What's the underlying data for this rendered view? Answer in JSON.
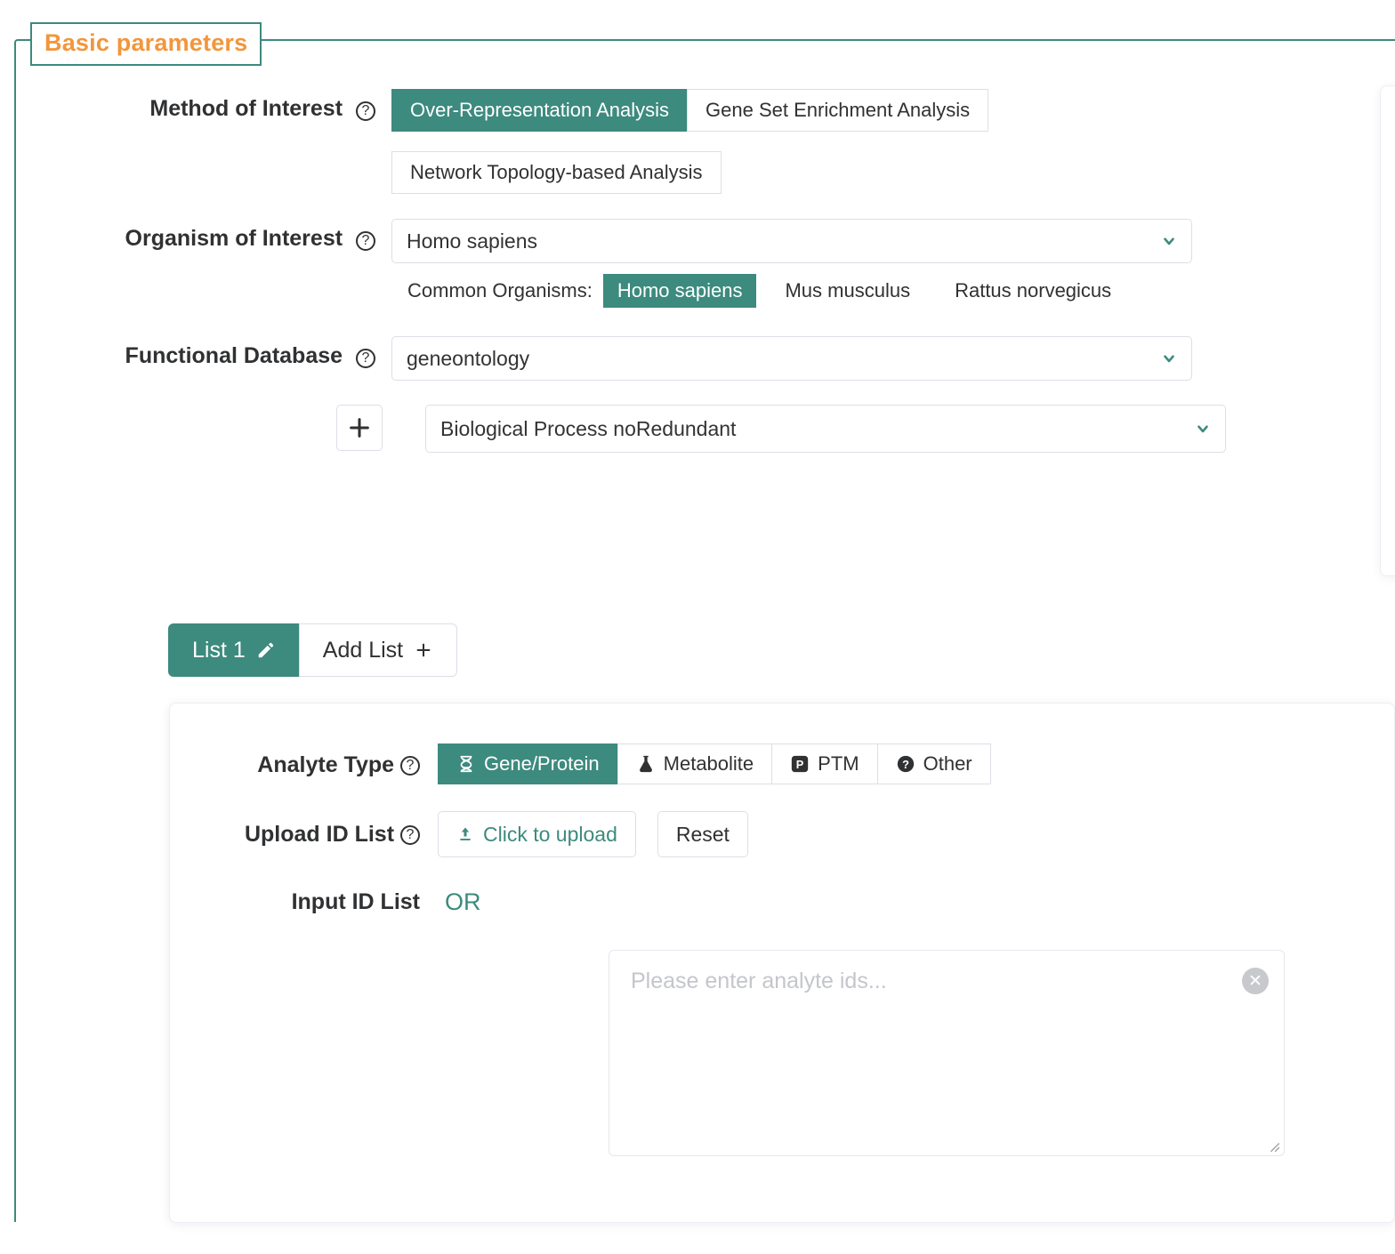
{
  "legend": {
    "title": "Basic parameters"
  },
  "method": {
    "label": "Method of Interest",
    "help_icon": "question-circle-icon",
    "options": [
      "Over-Representation Analysis",
      "Gene Set Enrichment Analysis",
      "Network Topology-based Analysis"
    ],
    "selected": "Over-Representation Analysis"
  },
  "organism": {
    "label": "Organism of Interest",
    "help_icon": "question-circle-icon",
    "selected": "Homo sapiens",
    "dropdown_icon": "chevron-down-icon",
    "common_label": "Common Organisms:",
    "common_options": [
      "Homo sapiens",
      "Mus musculus",
      "Rattus norvegicus"
    ],
    "common_selected": "Homo sapiens"
  },
  "database": {
    "label": "Functional Database",
    "help_icon": "question-circle-icon",
    "selected": "geneontology",
    "dropdown_icon": "chevron-down-icon",
    "add_icon": "plus-icon",
    "category_selected": "Biological Process noRedundant",
    "category_dropdown_icon": "chevron-down-icon"
  },
  "list_tabs": {
    "items": [
      {
        "label": "List 1",
        "icon": "pencil-icon",
        "active": true
      },
      {
        "label": "Add List",
        "icon": "plus-icon",
        "active": false
      }
    ]
  },
  "analyte": {
    "label": "Analyte Type",
    "help_icon": "question-circle-icon",
    "options": [
      {
        "label": "Gene/Protein",
        "icon": "dna-icon"
      },
      {
        "label": "Metabolite",
        "icon": "flask-icon"
      },
      {
        "label": "PTM",
        "icon": "p-square-icon"
      },
      {
        "label": "Other",
        "icon": "question-circle-filled-icon"
      }
    ],
    "selected": "Gene/Protein"
  },
  "upload": {
    "label": "Upload ID List",
    "help_icon": "question-circle-icon",
    "upload_label": "Click to upload",
    "upload_icon": "upload-icon",
    "reset_label": "Reset"
  },
  "input_list": {
    "label": "Input ID List",
    "or_text": "OR",
    "placeholder": "Please enter analyte ids...",
    "value": "",
    "clear_icon": "close-circle-icon"
  },
  "colors": {
    "accent_teal": "#3d8a7e",
    "legend_orange": "#f2963c",
    "border_gray": "#dcdfe6",
    "text_dark": "#303133"
  }
}
